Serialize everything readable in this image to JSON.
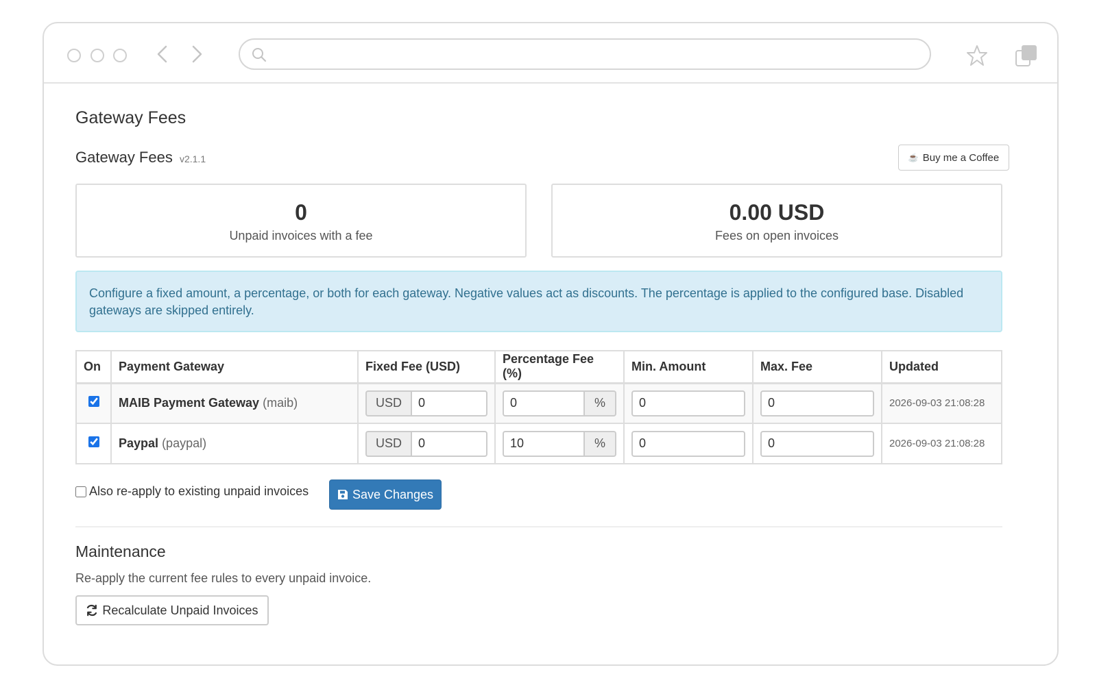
{
  "page": {
    "title": "Gateway Fees",
    "module_name": "Gateway Fees",
    "module_version": "v2.1.1",
    "coffee_button": "Buy me a Coffee"
  },
  "stats": [
    {
      "value": "0",
      "label": "Unpaid invoices with a fee"
    },
    {
      "value": "0.00 USD",
      "label": "Fees on open invoices"
    }
  ],
  "info_alert": "Configure a fixed amount, a percentage, or both for each gateway. Negative values act as discounts. The percentage is applied to the configured base. Disabled gateways are skipped entirely.",
  "table": {
    "headers": [
      "On",
      "Payment Gateway",
      "Fixed Fee (USD)",
      "Percentage Fee (%)",
      "Min. Amount",
      "Max. Fee",
      "Updated"
    ],
    "rows": [
      {
        "enabled": true,
        "name": "MAIB Payment Gateway",
        "code": "(maib)",
        "currency": "USD",
        "fixed_fee": "0",
        "percent_fee": "0",
        "percent_symbol": "%",
        "min_amount": "0",
        "max_fee": "0",
        "updated": "2026-09-03 21:08:28"
      },
      {
        "enabled": true,
        "name": "Paypal",
        "code": "(paypal)",
        "currency": "USD",
        "fixed_fee": "0",
        "percent_fee": "10",
        "percent_symbol": "%",
        "min_amount": "0",
        "max_fee": "0",
        "updated": "2026-09-03 21:08:28"
      }
    ]
  },
  "reapply_label": "Also re-apply to existing unpaid invoices",
  "reapply_checked": false,
  "save_button": "Save Changes",
  "maintenance": {
    "title": "Maintenance",
    "description": "Re-apply the current fee rules to every unpaid invoice.",
    "button": "Recalculate Unpaid Invoices"
  },
  "colors": {
    "primary": "#337ab7",
    "info_bg": "#d9edf7",
    "info_text": "#31708f",
    "checkbox": "#1a73e8"
  },
  "icons": [
    "search-icon",
    "back-icon",
    "forward-icon",
    "star-icon",
    "tabs-icon",
    "coffee-icon",
    "save-icon",
    "refresh-icon"
  ]
}
